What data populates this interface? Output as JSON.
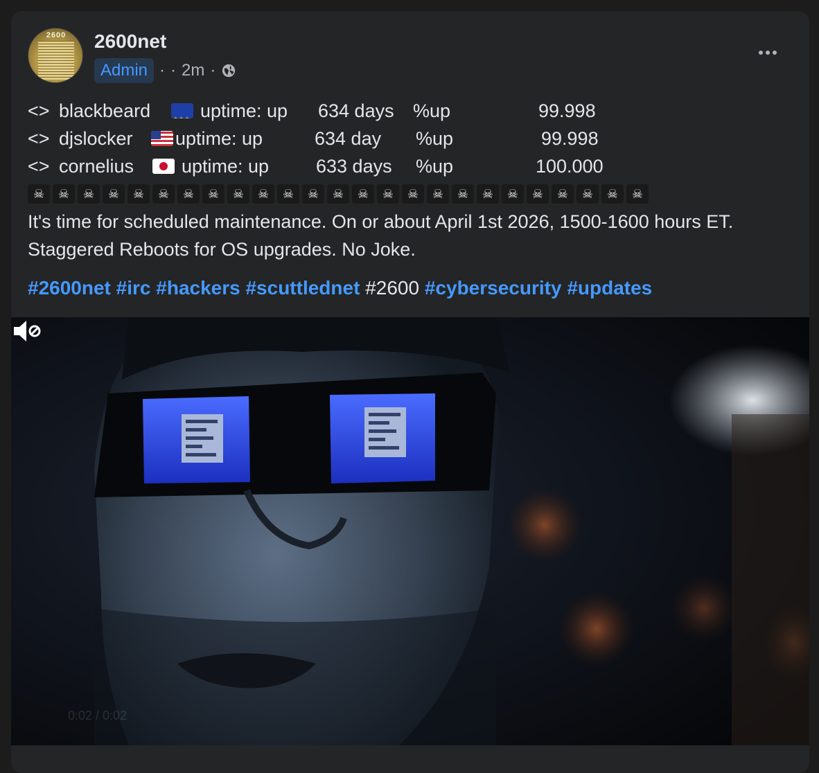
{
  "post": {
    "author": "2600net",
    "role_badge": "Admin",
    "meta_sep1": "·",
    "meta_sep2": "·",
    "time": "2m",
    "meta_sep3": "·",
    "icons": {
      "avatar": "2600-magazine-avatar",
      "privacy": "globe-icon",
      "more": "more-horizontal-icon",
      "mute": "speaker-muted-icon"
    },
    "uptime_rows": [
      {
        "prefix": "<>",
        "name": "blackbeard",
        "flag": "eu-flag",
        "label": "uptime: up",
        "days": "634 days",
        "pct_label": "%up",
        "pct": "99.998"
      },
      {
        "prefix": "<>",
        "name": "djslocker",
        "flag": "us-flag",
        "label": "uptime: up",
        "days": "634 day",
        "pct_label": "%up",
        "pct": "99.998"
      },
      {
        "prefix": "<>",
        "name": "cornelius",
        "flag": "jp-flag",
        "label": "uptime: up",
        "days": "633 days",
        "pct_label": "%up",
        "pct": "100.000"
      }
    ],
    "skull_emoji": "☠",
    "skull_count": 25,
    "message": "It's time for scheduled maintenance. On or about April 1st 2026, 1500-1600 hours ET. Staggered Reboots for OS upgrades. No Joke.",
    "hashtags": [
      {
        "text": "#2600net",
        "linked": true
      },
      {
        "text": "#irc",
        "linked": true
      },
      {
        "text": "#hackers",
        "linked": true
      },
      {
        "text": "#scuttlednet",
        "linked": true
      },
      {
        "text": "#2600",
        "linked": false
      },
      {
        "text": "#cybersecurity",
        "linked": true
      },
      {
        "text": "#updates",
        "linked": true
      }
    ],
    "video": {
      "time_display": "0:02 / 0:02"
    }
  },
  "colors": {
    "page_bg": "#1c1c1d",
    "card_bg": "#242526",
    "link": "#4599ff",
    "badge_bg": "#263951",
    "text": "#e4e6eb",
    "secondary_text": "#b0b3b8",
    "visor_glow": "#2a4dff"
  }
}
